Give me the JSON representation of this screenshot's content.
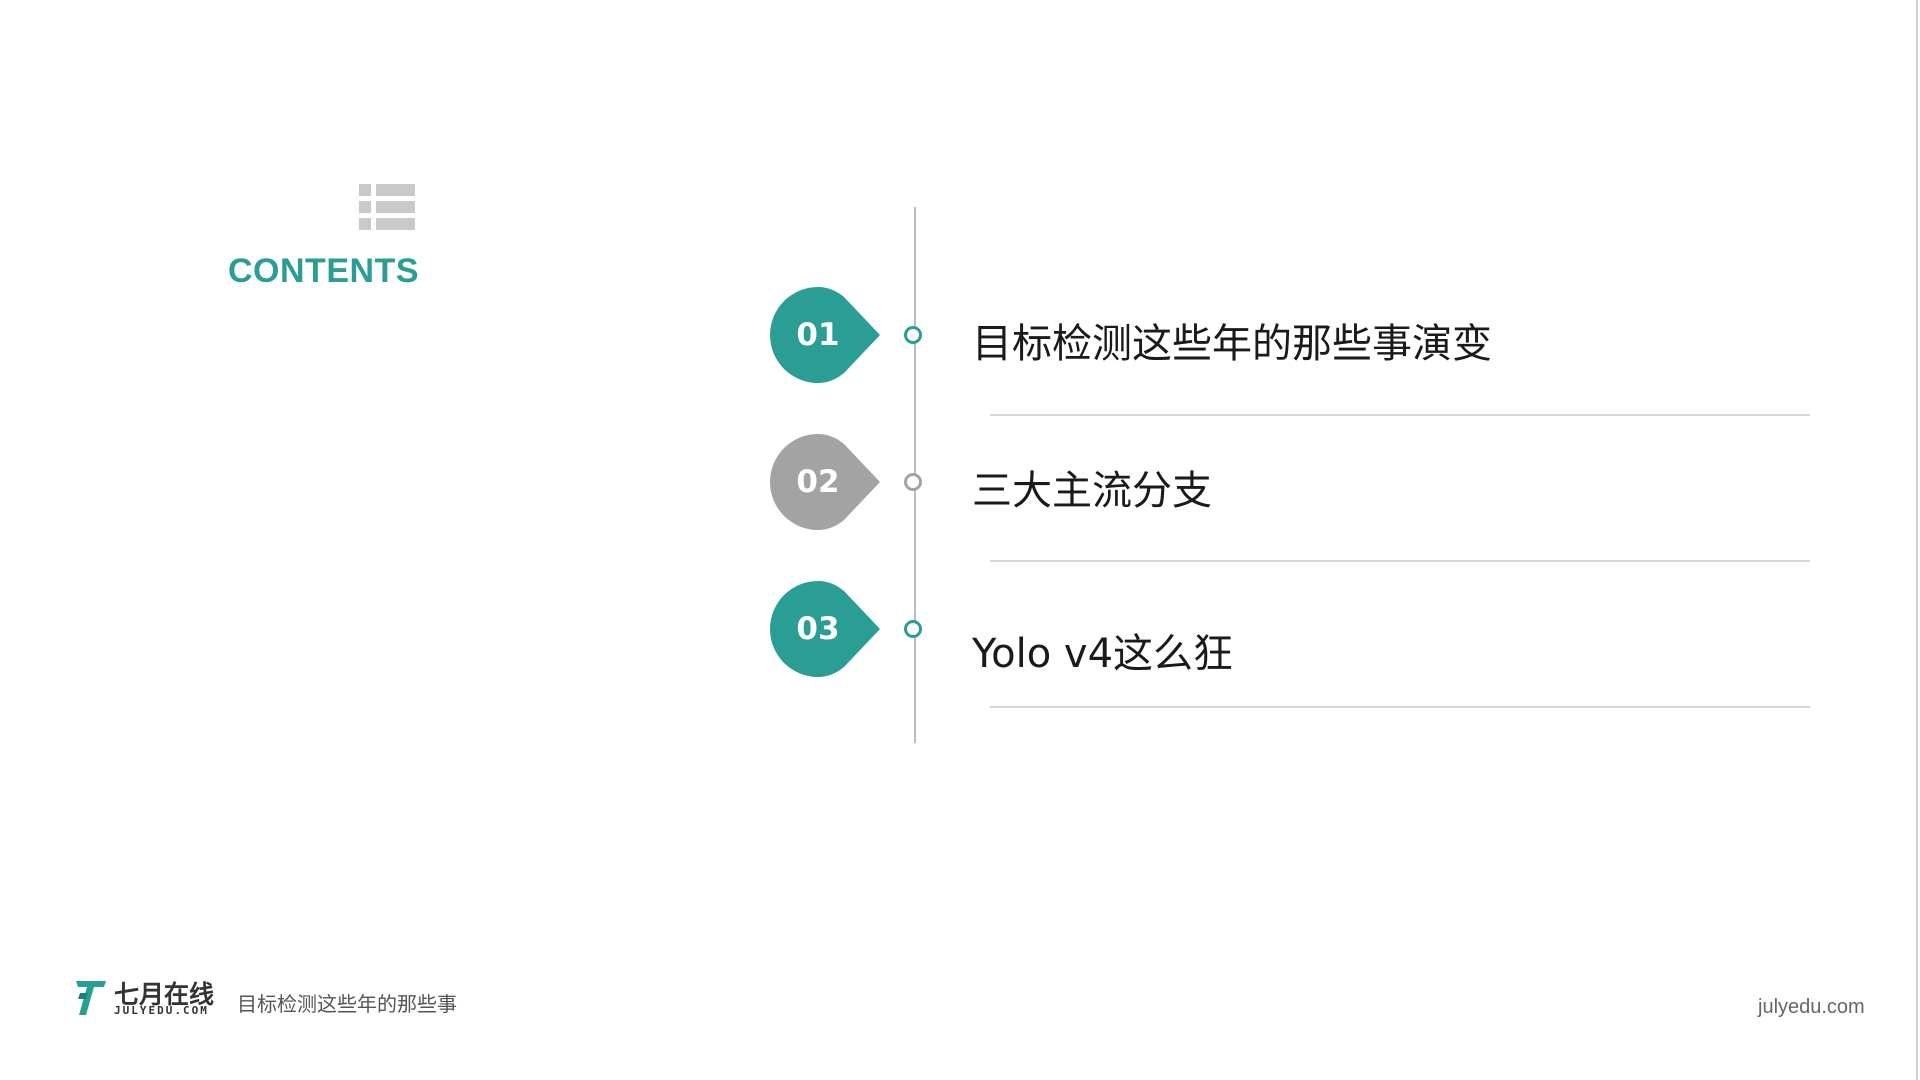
{
  "slide": {
    "contents_title": "CONTENTS",
    "items": [
      {
        "number": "01",
        "label": "目标检测这些年的那些事演变",
        "color": "#2a9d95"
      },
      {
        "number": "02",
        "label": "三大主流分支",
        "color": "#a3a3a3"
      },
      {
        "number": "03",
        "label": "Yolo v4这么狂",
        "color": "#2a9d95"
      }
    ]
  },
  "footer": {
    "logo_cn": "七月在线",
    "logo_en": "JULYEDU.COM",
    "subtitle": "目标检测这些年的那些事",
    "url": "julyedu.com"
  },
  "icons": {
    "contents_icon": "list-icon",
    "logo_icon": "julyedu-logo-icon"
  },
  "colors": {
    "accent": "#2a9d95",
    "inactive": "#a3a3a3"
  }
}
